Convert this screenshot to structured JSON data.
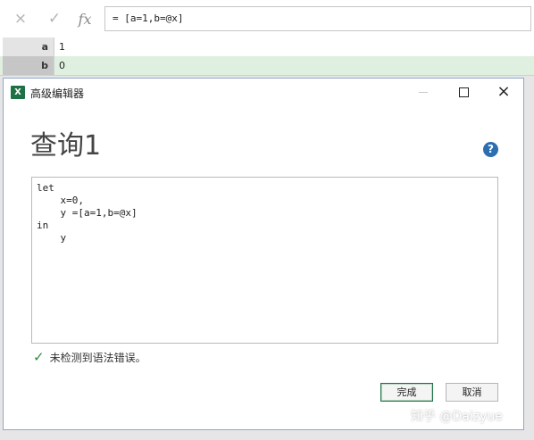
{
  "formula_bar": {
    "cancel_icon": "×",
    "enter_icon": "✓",
    "fx_label": "fx",
    "formula": "= [a=1,b=@x]"
  },
  "rows": [
    {
      "name": "a",
      "value": "1"
    },
    {
      "name": "b",
      "value": "0"
    }
  ],
  "dialog": {
    "app_icon_letter": "X",
    "title": "高级编辑器",
    "query_name": "查询1",
    "help_icon": "?",
    "code": "let\n    x=0,\n    y =[a=1,b=@x]\nin\n    y",
    "status_icon": "✓",
    "status": "未检测到语法错误。",
    "buttons": {
      "done": "完成",
      "cancel": "取消"
    },
    "close_glyph": "×"
  },
  "watermark": "知乎 @Daizyue",
  "colors": {
    "excel_green": "#1e7145",
    "help_blue": "#2d6eb0",
    "selected_row": "#dff0e0"
  }
}
